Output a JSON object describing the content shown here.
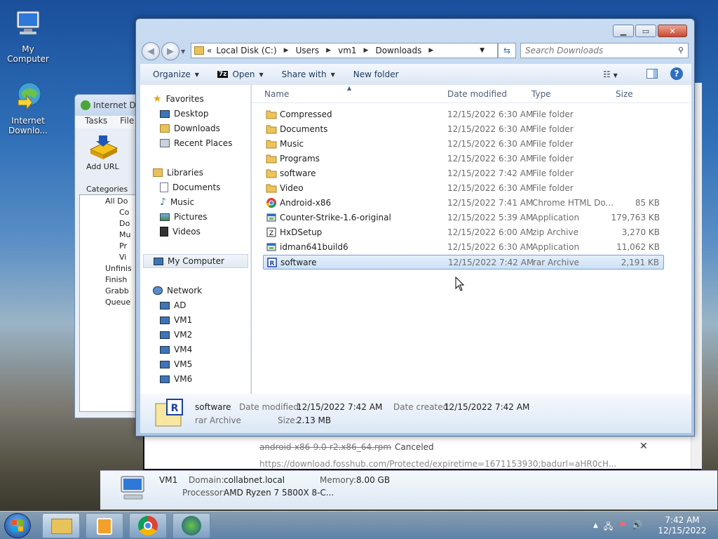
{
  "desktop": {
    "icons": [
      {
        "label": "My Computer"
      },
      {
        "label": "Internet Downlo..."
      }
    ]
  },
  "idm": {
    "title": "Internet Do",
    "menu": [
      "Tasks",
      "File"
    ],
    "add_url": "Add URL",
    "categories_label": "Categories",
    "tree": [
      "All Do",
      "Co",
      "Do",
      "Mu",
      "Pr",
      "Vi",
      "Unfinis",
      "Finish",
      "Grabb",
      "Queue"
    ]
  },
  "download_row": {
    "name": "android-x86-9.0-r2.x86_64.rpm",
    "status": "Canceled",
    "url": "https://download.fosshub.com/Protected/expiretime=1671153930;badurl=aHR0cH..."
  },
  "computer_info": {
    "name": "VM1",
    "domain_label": "Domain:",
    "domain": "collabnet.local",
    "memory_label": "Memory:",
    "memory": "8.00 GB",
    "processor_label": "Processor:",
    "processor": "AMD Ryzen 7 5800X 8-C..."
  },
  "explorer": {
    "breadcrumb": [
      "«",
      "Local Disk (C:)",
      "Users",
      "vm1",
      "Downloads"
    ],
    "search_placeholder": "Search Downloads",
    "commands": {
      "organize": "Organize",
      "open": "Open",
      "share_with": "Share with",
      "new_folder": "New folder"
    },
    "nav": {
      "favorites": "Favorites",
      "favorites_items": [
        "Desktop",
        "Downloads",
        "Recent Places"
      ],
      "libraries": "Libraries",
      "libraries_items": [
        "Documents",
        "Music",
        "Pictures",
        "Videos"
      ],
      "computer": "My Computer",
      "network": "Network",
      "network_items": [
        "AD",
        "VM1",
        "VM2",
        "VM4",
        "VM5",
        "VM6"
      ]
    },
    "columns": {
      "name": "Name",
      "date": "Date modified",
      "type": "Type",
      "size": "Size"
    },
    "files": [
      {
        "name": "Compressed",
        "date": "12/15/2022 6:30 AM",
        "type": "File folder",
        "size": "",
        "icon": "folder-icon"
      },
      {
        "name": "Documents",
        "date": "12/15/2022 6:30 AM",
        "type": "File folder",
        "size": "",
        "icon": "folder-icon"
      },
      {
        "name": "Music",
        "date": "12/15/2022 6:30 AM",
        "type": "File folder",
        "size": "",
        "icon": "folder-icon"
      },
      {
        "name": "Programs",
        "date": "12/15/2022 6:30 AM",
        "type": "File folder",
        "size": "",
        "icon": "folder-icon"
      },
      {
        "name": "software",
        "date": "12/15/2022 7:42 AM",
        "type": "File folder",
        "size": "",
        "icon": "folder-icon"
      },
      {
        "name": "Video",
        "date": "12/15/2022 6:30 AM",
        "type": "File folder",
        "size": "",
        "icon": "folder-icon"
      },
      {
        "name": "Android-x86",
        "date": "12/15/2022 7:41 AM",
        "type": "Chrome HTML Do...",
        "size": "85 KB",
        "icon": "chrome-icon"
      },
      {
        "name": "Counter-Strike-1.6-original",
        "date": "12/15/2022 5:39 AM",
        "type": "Application",
        "size": "179,763 KB",
        "icon": "application-icon"
      },
      {
        "name": "HxDSetup",
        "date": "12/15/2022 6:00 AM",
        "type": "zip Archive",
        "size": "3,270 KB",
        "icon": "zip-icon"
      },
      {
        "name": "idman641build6",
        "date": "12/15/2022 6:30 AM",
        "type": "Application",
        "size": "11,062 KB",
        "icon": "application-icon"
      },
      {
        "name": "software",
        "date": "12/15/2022 7:42 AM",
        "type": "rar Archive",
        "size": "2,191 KB",
        "icon": "rar-icon"
      }
    ],
    "details": {
      "name": "software",
      "type": "rar Archive",
      "date_modified_label": "Date modified:",
      "date_modified": "12/15/2022 7:42 AM",
      "date_created_label": "Date created:",
      "date_created": "12/15/2022 7:42 AM",
      "size_label": "Size:",
      "size": "2.13 MB"
    }
  },
  "taskbar": {
    "time": "7:42 AM",
    "date": "12/15/2022"
  }
}
